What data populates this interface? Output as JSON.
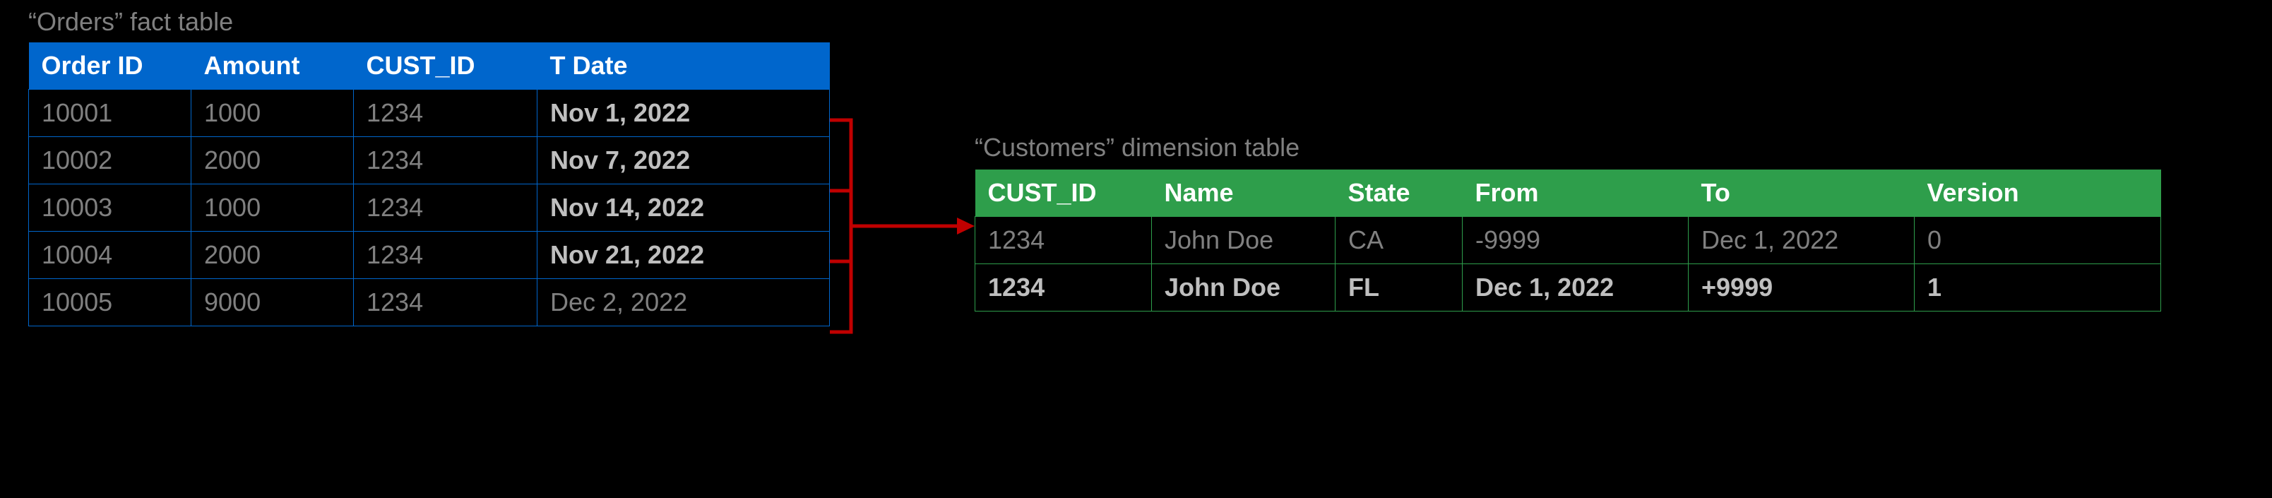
{
  "orders": {
    "caption": "“Orders” fact table",
    "columns": [
      "Order ID",
      "Amount",
      "CUST_ID",
      "T Date"
    ],
    "rows": [
      {
        "order_id": "10001",
        "amount": "1000",
        "cust_id": "1234",
        "t_date": "Nov 1, 2022",
        "bold_date": true
      },
      {
        "order_id": "10002",
        "amount": "2000",
        "cust_id": "1234",
        "t_date": "Nov 7, 2022",
        "bold_date": true
      },
      {
        "order_id": "10003",
        "amount": "1000",
        "cust_id": "1234",
        "t_date": "Nov 14, 2022",
        "bold_date": true
      },
      {
        "order_id": "10004",
        "amount": "2000",
        "cust_id": "1234",
        "t_date": "Nov 21, 2022",
        "bold_date": true
      },
      {
        "order_id": "10005",
        "amount": "9000",
        "cust_id": "1234",
        "t_date": "Dec 2, 2022",
        "bold_date": false
      }
    ]
  },
  "customers": {
    "caption": "“Customers” dimension table",
    "columns": [
      "CUST_ID",
      "Name",
      "State",
      "From",
      "To",
      "Version"
    ],
    "rows": [
      {
        "cust_id": "1234",
        "name": "John Doe",
        "state": "CA",
        "from": "-9999",
        "to": "Dec 1, 2022",
        "version": "0",
        "highlight": false
      },
      {
        "cust_id": "1234",
        "name": "John Doe",
        "state": "FL",
        "from": "Dec 1, 2022",
        "to": "+9999",
        "version": "1",
        "highlight": true
      }
    ]
  },
  "connector": {
    "color": "#C00000"
  }
}
